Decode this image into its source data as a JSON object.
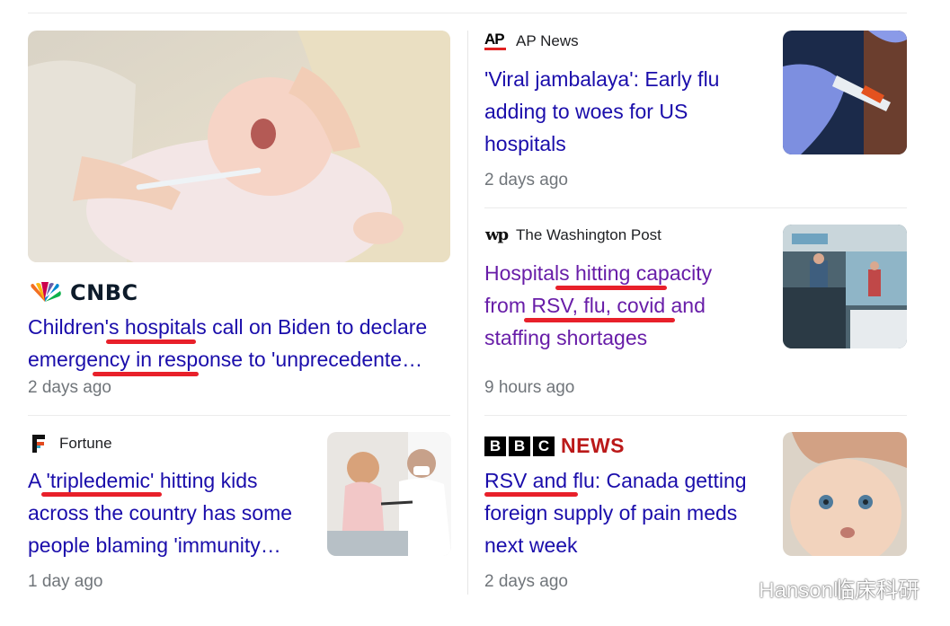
{
  "articles": [
    {
      "source": "CNBC",
      "headline_lines": [
        "Children's hospitals call on Biden to declare",
        "emergency in response to 'unprecedente…"
      ],
      "time": "2 days ago"
    },
    {
      "source": "AP News",
      "logo_text": "AP",
      "headline_lines": [
        "'Viral jambalaya': Early flu",
        "adding to woes for US",
        "hospitals"
      ],
      "time": "2 days ago"
    },
    {
      "source": "The Washington Post",
      "logo_text": "wp",
      "headline_lines": [
        "Hospitals hitting capacity",
        "from RSV, flu, covid and",
        "staffing shortages"
      ],
      "time": "9 hours ago"
    },
    {
      "source": "Fortune",
      "logo_text": "F",
      "headline_lines": [
        "A 'tripledemic' hitting kids",
        "across the country has some",
        "people blaming 'immunity…"
      ],
      "time": "1 day ago"
    },
    {
      "source": "BBC NEWS",
      "logo_letters": [
        "B",
        "B",
        "C"
      ],
      "logo_word": "NEWS",
      "headline_lines": [
        "RSV and flu: Canada getting",
        "foreign supply of pain meds",
        "next week"
      ],
      "time": "2 days ago"
    }
  ],
  "watermark": {
    "text": "Hanson临床科研"
  },
  "colors": {
    "link": "#1a0dab",
    "visited_link": "#681da8",
    "meta": "#70757a",
    "annotation_red": "#e8202a",
    "cnbc_blue": "#0d1b2a",
    "bbc_red": "#bb1919"
  },
  "icons": {
    "cnbc": "peacock-logo-icon",
    "wechat": "wechat-icon"
  }
}
